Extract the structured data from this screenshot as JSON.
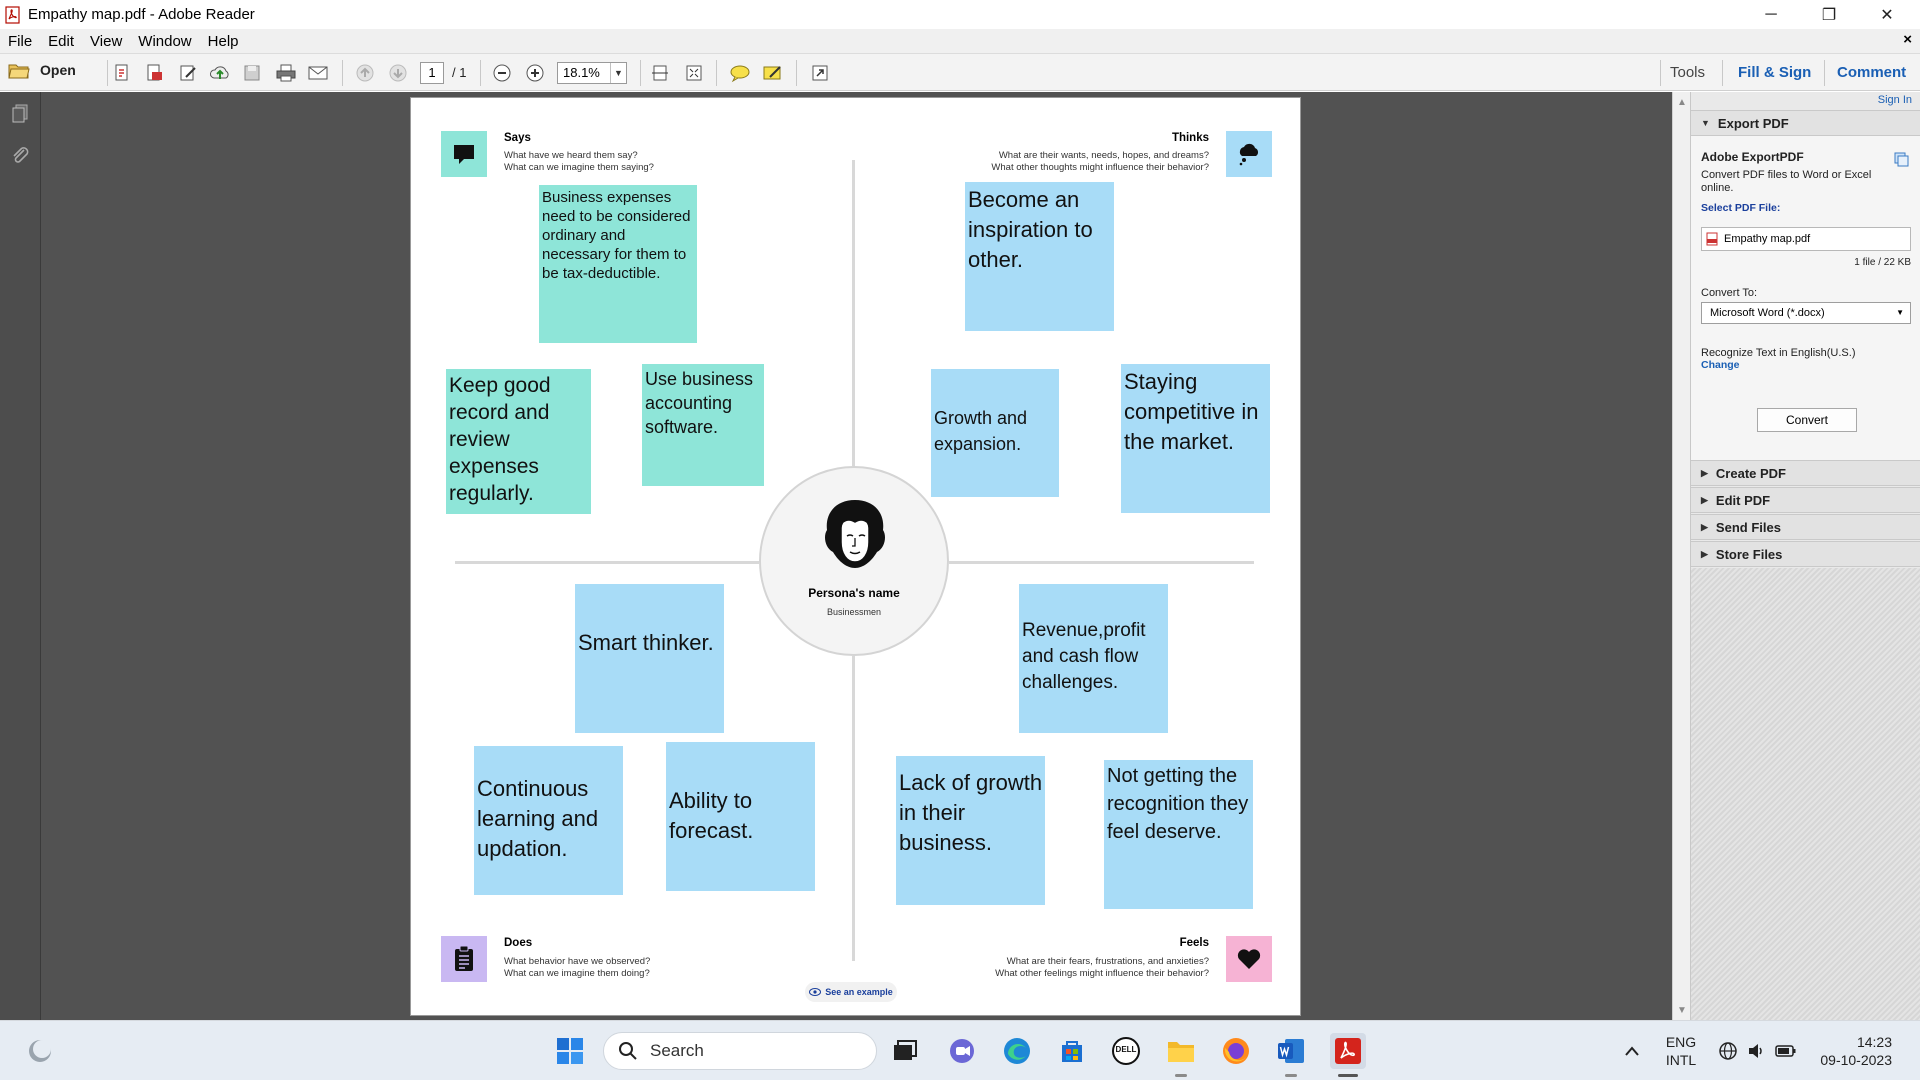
{
  "window": {
    "title": "Empathy map.pdf - Adobe Reader",
    "minimize": "─",
    "restore": "❐",
    "close": "✕"
  },
  "menu": {
    "items": [
      "File",
      "Edit",
      "View",
      "Window",
      "Help"
    ],
    "close_doc": "×"
  },
  "toolbar": {
    "open_label": "Open",
    "page_current": "1",
    "page_total": "/ 1",
    "zoom": "18.1%",
    "tools": "Tools",
    "fill_sign": "Fill & Sign",
    "comment": "Comment"
  },
  "empathy_map": {
    "says": {
      "title": "Says",
      "line1": "What have we heard them say?",
      "line2": "What can we imagine them saying?"
    },
    "thinks": {
      "title": "Thinks",
      "line1": "What are their wants, needs, hopes, and dreams?",
      "line2": "What other thoughts might influence their behavior?"
    },
    "does": {
      "title": "Does",
      "line1": "What behavior have we observed?",
      "line2": "What can we imagine them doing?"
    },
    "feels": {
      "title": "Feels",
      "line1": "What are their fears, frustrations, and anxieties?",
      "line2": "What other feelings might influence their behavior?"
    },
    "persona_name": "Persona's name",
    "persona_role": "Businessmen",
    "see_example": "See an example",
    "notes": [
      "Business expenses need to be considered ordinary and necessary for them to be tax-deductible.",
      "Keep good record and review expenses regularly.",
      "Use business accounting software.",
      "Become an inspiration to other.",
      "Growth and expansion.",
      "Staying competitive in the market.",
      "Smart thinker.",
      "Continuous learning and updation.",
      "Ability to forecast.",
      "Revenue,profit and cash flow challenges.",
      "Lack of growth in their business.",
      "Not getting the recognition they feel deserve."
    ]
  },
  "right_panel": {
    "sign_in": "Sign In",
    "export_pdf": "Export PDF",
    "adobe_exportpdf": "Adobe ExportPDF",
    "description": "Convert PDF files to Word or Excel online.",
    "select_label": "Select PDF File:",
    "file_name": "Empathy map.pdf",
    "file_count": "1 file / 22 KB",
    "convert_to_label": "Convert To:",
    "convert_to_value": "Microsoft Word (*.docx)",
    "recognize": "Recognize Text in English(U.S.)",
    "change": "Change",
    "convert_button": "Convert",
    "sections": [
      "Create PDF",
      "Edit PDF",
      "Send Files",
      "Store Files"
    ]
  },
  "taskbar": {
    "search_placeholder": "Search",
    "lang_top": "ENG",
    "lang_bottom": "INTL",
    "time": "14:23",
    "date": "09-10-2023",
    "dell_label": "DELL"
  },
  "colors": {
    "teal_note": "#8ee5d8",
    "blue_note": "#a8dcf7",
    "link_blue": "#1a5fb4",
    "doc_bg": "#525252"
  }
}
